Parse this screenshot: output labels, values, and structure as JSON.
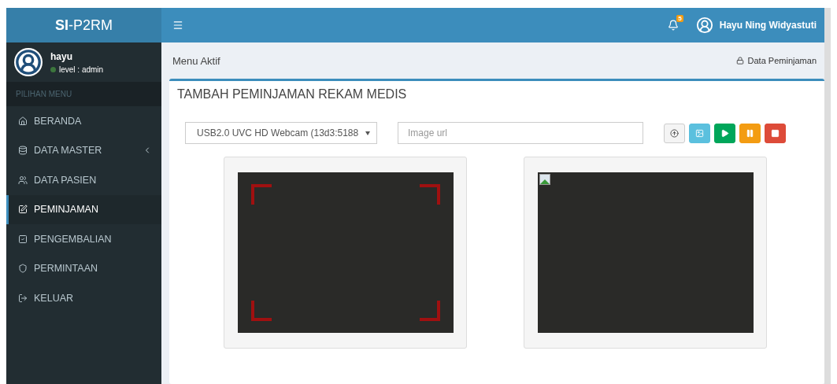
{
  "brand": {
    "bold": "SI",
    "rest": "-P2RM"
  },
  "user_panel": {
    "name": "hayu",
    "status": "level : admin",
    "online": true
  },
  "sidebar": {
    "header": "PILIHAN MENU",
    "items": [
      {
        "label": "BERANDA",
        "selected": false,
        "expandable": false
      },
      {
        "label": "DATA MASTER",
        "selected": false,
        "expandable": true
      },
      {
        "label": "DATA PASIEN",
        "selected": false,
        "expandable": false
      },
      {
        "label": "PEMINJAMAN",
        "selected": true,
        "expandable": false
      },
      {
        "label": "PENGEMBALIAN",
        "selected": false,
        "expandable": false
      },
      {
        "label": "PERMINTAAN",
        "selected": false,
        "expandable": false
      },
      {
        "label": "KELUAR",
        "selected": false,
        "expandable": false
      }
    ]
  },
  "topbar": {
    "notifications": "5",
    "user": "Hayu Ning Widyastuti"
  },
  "breadcrumb": {
    "title": "Menu Aktif",
    "current": "Data Peminjaman"
  },
  "box": {
    "title": "TAMBAH PEMINJAMAN REKAM MEDIS",
    "camera_select": {
      "value": "USB2.0 UVC HD Webcam (13d3:5188"
    },
    "image_url": {
      "placeholder": "Image url"
    },
    "buttons": [
      {
        "kind": "upload",
        "color": "#f4f4f4"
      },
      {
        "kind": "image",
        "color": "#5bc0de"
      },
      {
        "kind": "play",
        "color": "#00a65a"
      },
      {
        "kind": "pause",
        "color": "#f39c12"
      },
      {
        "kind": "stop",
        "color": "#dd4b39"
      }
    ],
    "panels": [
      {
        "kind": "scanner"
      },
      {
        "kind": "broken_image"
      }
    ]
  }
}
